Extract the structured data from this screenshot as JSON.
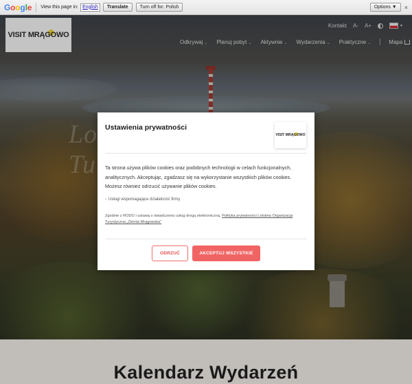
{
  "translate_bar": {
    "logo": [
      "G",
      "o",
      "o",
      "g",
      "l",
      "e"
    ],
    "prompt": "View this page in:",
    "language": "English",
    "translate_label": "Translate",
    "turn_off_label": "Turn off for: Polish",
    "options_label": "Options ▼",
    "close_glyph": "×"
  },
  "site": {
    "logo": {
      "before": "VISIT MR",
      "middle": "Ą",
      "after": "GOWO"
    },
    "topnav": {
      "contact": "Kontakt",
      "font_smaller": "A-",
      "font_larger": "A+",
      "language_arrow": "▾"
    },
    "mainnav": [
      {
        "label": "Odkrywaj"
      },
      {
        "label": "Planuj pobyt"
      },
      {
        "label": "Aktywnie"
      },
      {
        "label": "Wydarzenia"
      },
      {
        "label": "Praktyczne"
      }
    ],
    "map_label": "Mapa",
    "hero_title": "Lokalna Organizacja Turystyczna"
  },
  "modal": {
    "title": "Ustawienia prywatności",
    "logo": {
      "before": "VISIT MR",
      "middle": "Ą",
      "after": "GOWO"
    },
    "body": "Ta strona używa plików cookies oraz podobnych technologii w celach funkcjonalnych, analitycznych. Akceptując, zgadzasz się na wykorzystanie wszystkich plików cookies. Możesz również odrzucić używanie plików cookies.",
    "option": "Usługi wspomagające działalność firmy",
    "legal_prefix": "Zgodnie z RODO i ustawą o świadczeniu usług drogą elektroniczną. ",
    "legal_link": "Polityka prywatności Lokalna Organizacja Turystyczna „Ziemia Mrągowska”",
    "reject_label": "ODRZUĆ",
    "accept_label": "AKCEPTUJ WSZYSTKIE"
  },
  "lower": {
    "title": "Kalendarz Wydarzeń"
  },
  "colors": {
    "accent": "#f16464",
    "logo_yellow": "#f2d930"
  }
}
